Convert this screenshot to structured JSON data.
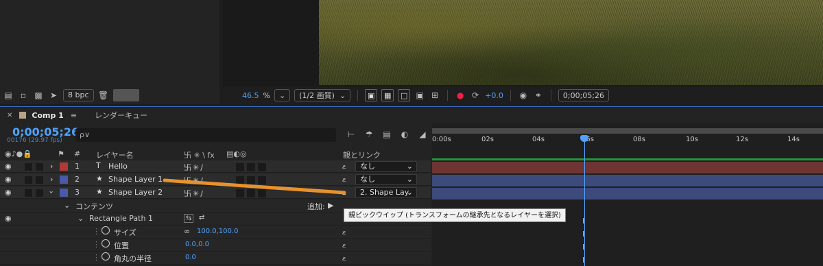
{
  "project": {
    "bpc_label": "8 bpc",
    "icons": [
      "render-queue-icon",
      "folder-icon",
      "composition-icon",
      "flowchart-icon",
      "trash-icon"
    ]
  },
  "viewer": {
    "zoom": "46.5",
    "zoom_unit": "%",
    "resolution": "(1/2 画質)",
    "exposure": "+0.0",
    "timecode": "0;00;05;26"
  },
  "timeline": {
    "tab_label": "Comp 1",
    "render_tab": "レンダーキュー",
    "timecode": "0;00;05;26",
    "frame_fps": "00176 (29.97 fps)",
    "search_placeholder": "ρ∨",
    "headers": {
      "num": "#",
      "layer_name": "レイヤー名",
      "parent": "親とリンク",
      "switches": "卐 ✳ \\ fx"
    },
    "layers": [
      {
        "num": "1",
        "type_icon": "T",
        "name": "Hello",
        "color": "#b03a3a",
        "parent": "なし"
      },
      {
        "num": "2",
        "type_icon": "★",
        "name": "Shape Layer 1",
        "color": "#4a5aa8",
        "parent": "なし"
      },
      {
        "num": "3",
        "type_icon": "★",
        "name": "Shape Layer 2",
        "color": "#4a5aa8",
        "parent": "2. Shape Lay"
      }
    ],
    "contents_label": "コンテンツ",
    "add_label": "追加:",
    "rect_path_label": "Rectangle Path 1",
    "props": [
      {
        "label": "サイズ",
        "value": "100.0,100.0"
      },
      {
        "label": "位置",
        "value": "0.0,0.0"
      },
      {
        "label": "角丸の半径",
        "value": "0.0"
      }
    ],
    "tooltip": "親ピックウイップ (トランスフォームの継承先となるレイヤーを選択)",
    "ruler": [
      "0:00s",
      "02s",
      "04s",
      "06s",
      "08s",
      "10s",
      "12s",
      "14s"
    ],
    "keyframe_glyph": "I"
  },
  "colors": {
    "accent": "#4fa3ff",
    "layer1_track": "#6e3434",
    "layer2_track": "#3c4a7c",
    "layer3_track": "#3c4a7c",
    "pickwhip": "#e8922c",
    "green_bar": "#1d9a3a"
  }
}
